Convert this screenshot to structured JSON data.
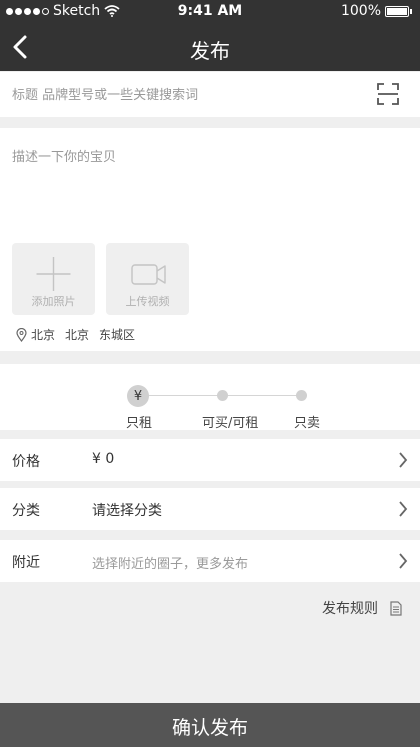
{
  "status_bar": {
    "carrier": "Sketch",
    "time": "9:41 AM",
    "battery": "100%"
  },
  "header": {
    "title": "发布"
  },
  "title_field": {
    "placeholder": "标题 品牌型号或一些关键搜索词"
  },
  "description": {
    "placeholder": "描述一下你的宝贝"
  },
  "media": {
    "add_photo": "添加照片",
    "upload_video": "上传视频"
  },
  "location": {
    "province": "北京",
    "city": "北京",
    "district": "东城区"
  },
  "trade_mode": {
    "currency_symbol": "¥",
    "options": [
      "只租",
      "可买/可租",
      "只卖"
    ],
    "selected": "只租"
  },
  "rows": {
    "price": {
      "label": "价格",
      "value": "¥  0"
    },
    "category": {
      "label": "分类",
      "value": "请选择分类"
    },
    "nearby": {
      "label": "附近",
      "value": "选择附近的圈子，更多发布"
    }
  },
  "rules_link": "发布规则",
  "confirm_button": "确认发布"
}
